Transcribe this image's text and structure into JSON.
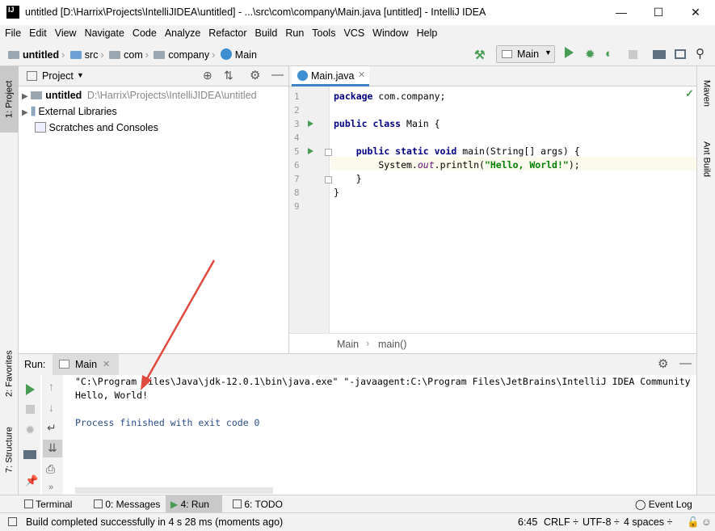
{
  "window": {
    "title": "untitled [D:\\Harrix\\Projects\\IntelliJIDEA\\untitled] - ...\\src\\com\\company\\Main.java [untitled] - IntelliJ IDEA",
    "logo": "IJ",
    "minimize": "—",
    "maximize": "☐",
    "close": "✕"
  },
  "menu": [
    "File",
    "Edit",
    "View",
    "Navigate",
    "Code",
    "Analyze",
    "Refactor",
    "Build",
    "Run",
    "Tools",
    "VCS",
    "Window",
    "Help"
  ],
  "breadcrumb": [
    "untitled",
    "src",
    "com",
    "company",
    "Main"
  ],
  "toolbar": {
    "run_config": "Main"
  },
  "left_strip": {
    "project": "1: Project",
    "favorites": "2: Favorites",
    "structure": "7: Structure"
  },
  "right_strip": {
    "maven": "Maven",
    "ant": "Ant Build"
  },
  "project_panel": {
    "title": "Project",
    "tree": [
      {
        "label": "untitled",
        "path": "D:\\Harrix\\Projects\\IntelliJIDEA\\untitled"
      },
      {
        "label": "External Libraries"
      },
      {
        "label": "Scratches and Consoles"
      }
    ]
  },
  "editor": {
    "tab": "Main.java",
    "line_numbers": [
      "1",
      "2",
      "3",
      "4",
      "5",
      "6",
      "7",
      "8",
      "9"
    ],
    "code": {
      "l1_kw": "package",
      "l1_rest": " com.company;",
      "l3_kw": "public class",
      "l3_rest": " Main {",
      "l5_indent": "    ",
      "l5_kw": "public static void",
      "l5_rest": " main(String[] args) {",
      "l6_indent": "        System.",
      "l6_field": "out",
      "l6_call": ".println(",
      "l6_str": "\"Hello, World!\"",
      "l6_end": ");",
      "l7": "    }",
      "l8": "}"
    },
    "crumbs": [
      "Main",
      "main()"
    ]
  },
  "run_panel": {
    "label": "Run:",
    "tab": "Main",
    "output": [
      "\"C:\\Program Files\\Java\\jdk-12.0.1\\bin\\java.exe\" \"-javaagent:C:\\Program Files\\JetBrains\\IntelliJ IDEA Community",
      "Hello, World!",
      "",
      "Process finished with exit code 0"
    ]
  },
  "bottom_tabs": {
    "terminal": "Terminal",
    "messages": "0: Messages",
    "run": "4: Run",
    "todo": "6: TODO",
    "event_log": "Event Log"
  },
  "status": {
    "message": "Build completed successfully in 4 s 28 ms (moments ago)",
    "position": "6:45",
    "line_sep": "CRLF ÷",
    "encoding": "UTF-8 ÷",
    "indent": "4 spaces ÷"
  },
  "colors": {
    "accent_run": "#499c54",
    "annotation_arrow": "#e04a3f",
    "keyword": "#000080",
    "string": "#008000"
  }
}
